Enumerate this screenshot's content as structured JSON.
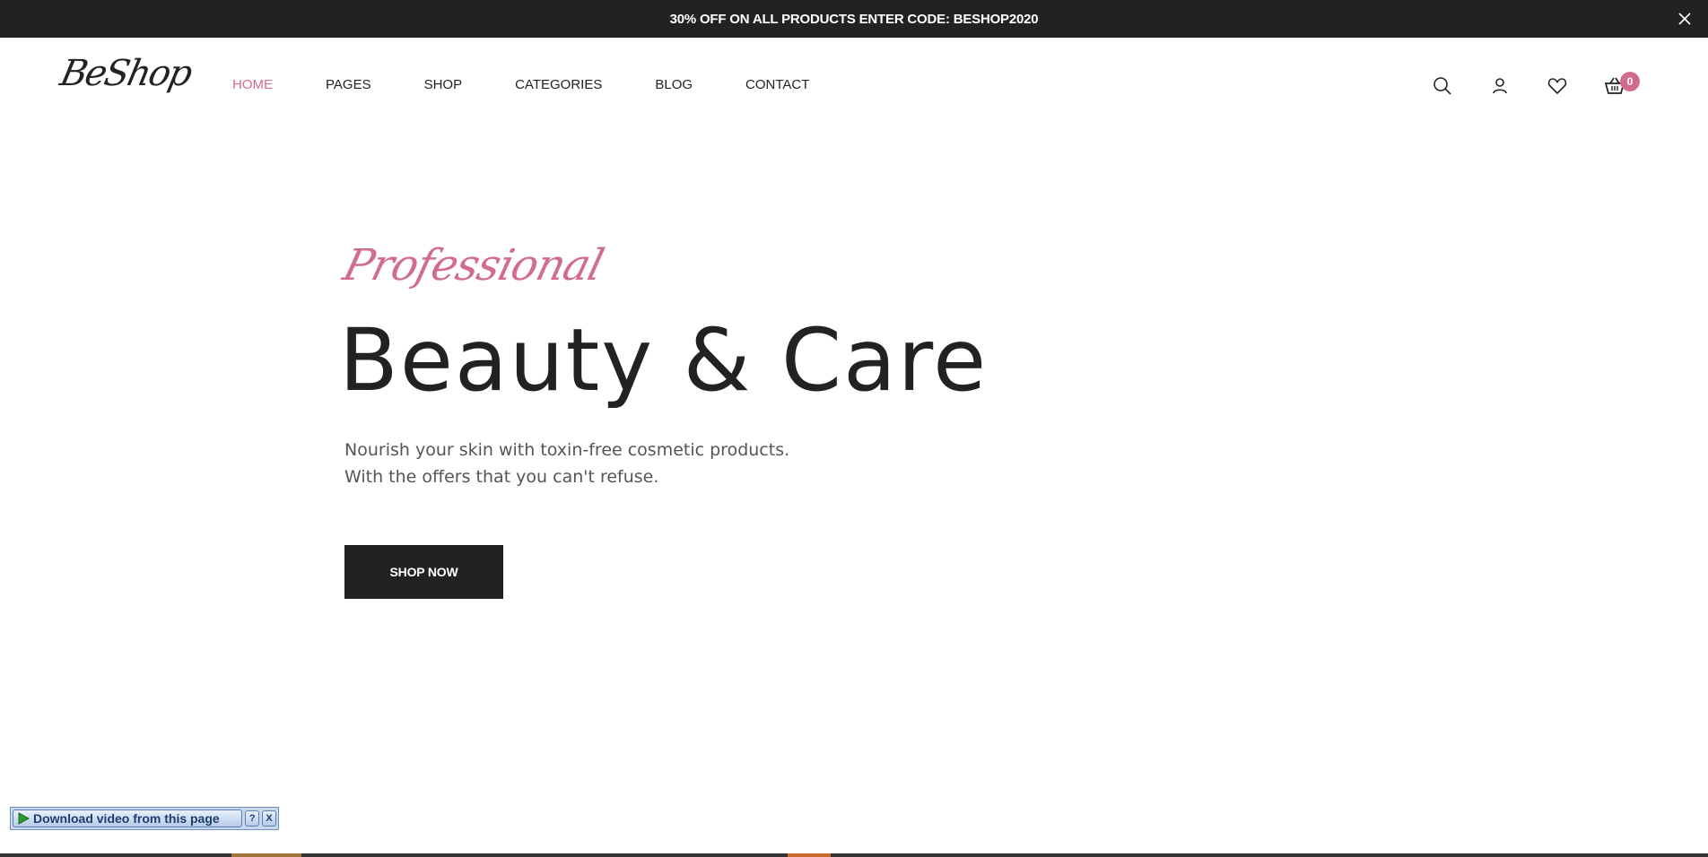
{
  "promo": {
    "text": "30% OFF ON ALL PRODUCTS ENTER CODE: BESHOP2020"
  },
  "header": {
    "logo": "BeShop",
    "nav": [
      {
        "label": "HOME",
        "active": true
      },
      {
        "label": "PAGES",
        "active": false
      },
      {
        "label": "SHOP",
        "active": false
      },
      {
        "label": "CATEGORIES",
        "active": false
      },
      {
        "label": "BLOG",
        "active": false
      },
      {
        "label": "CONTACT",
        "active": false
      }
    ],
    "cart_count": "0"
  },
  "hero": {
    "script": "Professional",
    "title": "Beauty & Care",
    "description": "Nourish your skin with toxin-free cosmetic products. With the offers that you can't refuse.",
    "button": "SHOP NOW"
  },
  "video_bar": {
    "label": "Download video from this page",
    "help": "?",
    "close": "X"
  },
  "colors": {
    "accent": "#d26c8e",
    "dark": "#222222"
  }
}
